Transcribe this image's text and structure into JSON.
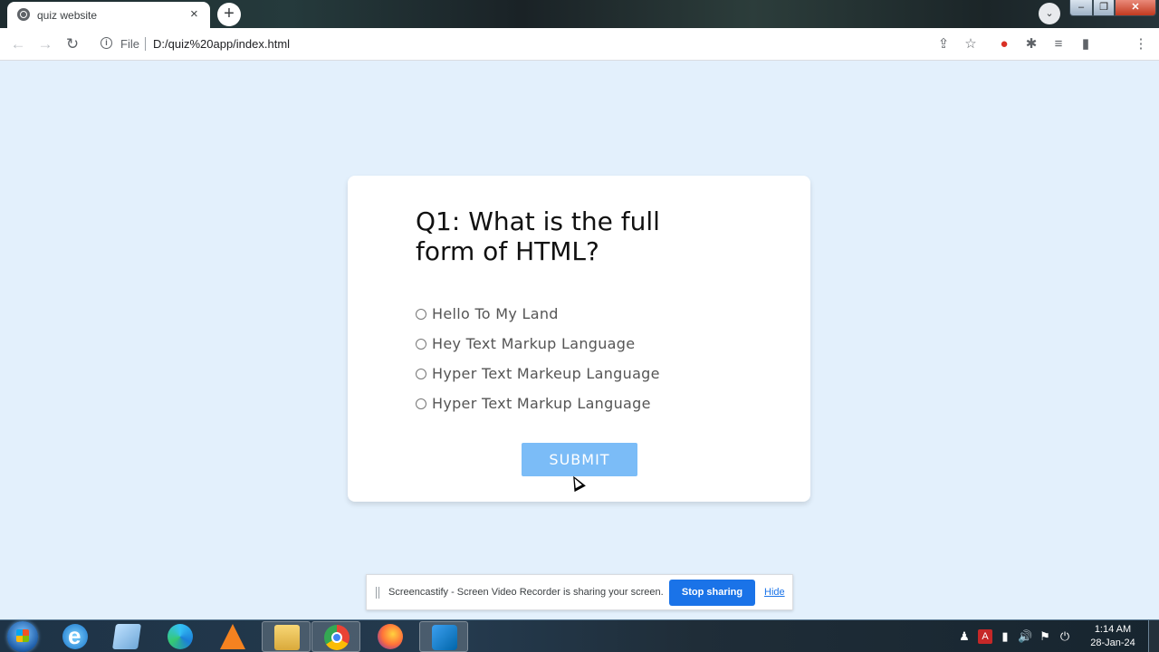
{
  "browser": {
    "tab_title": "quiz website",
    "tab_close": "×",
    "new_tab": "+",
    "tab_search": "⌄",
    "window_buttons": {
      "minimize": "–",
      "maximize": "❐",
      "close": "✕"
    },
    "nav": {
      "back": "←",
      "forward": "→",
      "reload": "↻"
    },
    "address": {
      "info": "i",
      "scheme": "File",
      "url": "D:/quiz%20app/index.html"
    },
    "toolbar_icons": {
      "share": "⇪",
      "bookmark": "☆",
      "screencastify": "●",
      "extensions": "✱",
      "reading_list": "≡",
      "side_panel": "▮",
      "menu": "⋮"
    }
  },
  "quiz": {
    "question": "Q1: What is the full form of HTML?",
    "answers": [
      "Hello To My Land",
      "Hey Text Markup Language",
      "Hyper Text Markeup Language",
      "Hyper Text Markup Language"
    ],
    "submit_label": "SUBMIT"
  },
  "share_banner": {
    "message": "Screencastify - Screen Video Recorder is sharing your screen.",
    "stop_label": "Stop sharing",
    "hide_label": "Hide"
  },
  "taskbar": {
    "tray_glyphs": {
      "user": "♟",
      "antivirus": "A",
      "network": "▮",
      "volume": "🔊",
      "flag": "⚑",
      "power": "⏻"
    },
    "time": "1:14 AM",
    "date": "28-Jan-24"
  },
  "colors": {
    "page_background": "#e3f0fc",
    "submit_background": "#7bbcf7",
    "stop_button": "#1a73e8"
  }
}
